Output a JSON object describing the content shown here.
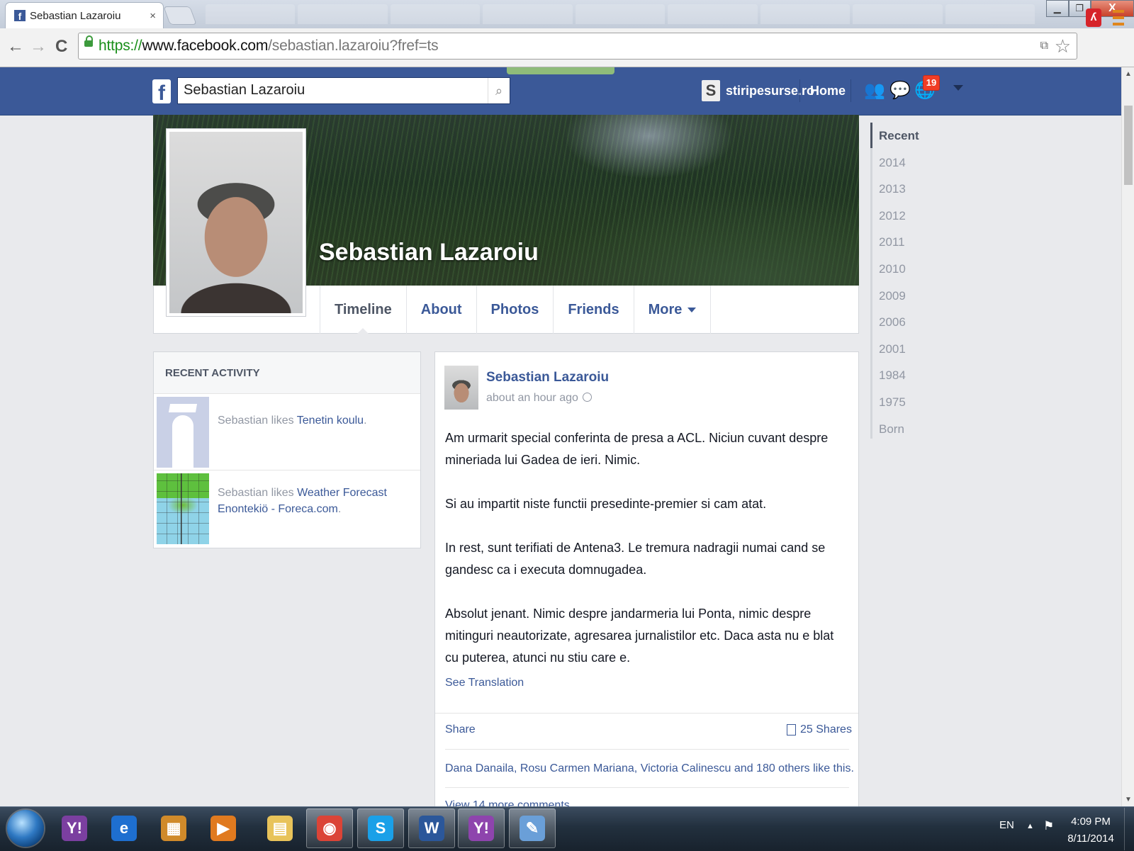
{
  "browser": {
    "tab_title": "Sebastian Lazaroiu",
    "tab_close": "×",
    "url_scheme": "https://",
    "url_host": "www.facebook.com",
    "url_path": "/sebastian.lazaroiu?fref=ts",
    "controls": {
      "minimize": "▁",
      "maximize": "❐",
      "close": "X"
    },
    "nav": {
      "back": "←",
      "forward": "→",
      "reload": "C"
    },
    "icons": [
      "lock-icon",
      "translate-icon",
      "star-icon",
      "extension-icon",
      "menu-icon"
    ]
  },
  "fb_nav": {
    "logo": "f",
    "search_value": "Sebastian Lazaroiu",
    "search_icon": "🔍",
    "page_link": "stiripesurse.ro",
    "page_icon": "S",
    "home": "Home",
    "notifications_count": "19",
    "jewels": [
      "friends-icon",
      "messages-icon",
      "notifications-icon"
    ]
  },
  "profile": {
    "name": "Sebastian Lazaroiu",
    "tabs": [
      "Timeline",
      "About",
      "Photos",
      "Friends",
      "More"
    ]
  },
  "recent_activity": {
    "title": "RECENT ACTIVITY",
    "items": [
      {
        "prefix": "Sebastian likes ",
        "object": "Tenetin koulu",
        "suffix": "."
      },
      {
        "prefix": "Sebastian likes ",
        "object": "Weather Forecast Enontekiö - Foreca.com",
        "suffix": "."
      }
    ]
  },
  "story": {
    "author": "Sebastian Lazaroiu",
    "time": "about an hour ago",
    "paragraphs": [
      "Am urmarit special conferinta de presa a ACL. Niciun cuvant despre mineriada lui Gadea de ieri. Nimic.",
      "Si au impartit niste functii presedinte-premier si cam atat.",
      "In rest, sunt terifiati de Antena3. Le tremura nadragii numai cand se gandesc ca i executa domnugadea.",
      "Absolut jenant. Nimic despre jandarmeria lui Ponta, nimic despre mitinguri neautorizate, agresarea jurnalistilor etc. Daca asta nu e blat cu puterea, atunci nu stiu care e."
    ],
    "see_translation": "See Translation",
    "share": "Share",
    "shares": "25 Shares",
    "likes": "Dana Danaila, Rosu Carmen Mariana, Victoria Calinescu and 180 others like this.",
    "more_comments": "View 14 more comments"
  },
  "timeline_years": [
    "Recent",
    "2014",
    "2013",
    "2012",
    "2011",
    "2010",
    "2009",
    "2006",
    "2001",
    "1984",
    "1975",
    "Born"
  ],
  "taskbar": {
    "apps": [
      {
        "name": "yahoo-messenger",
        "label": "Y!",
        "color": "#7b3fa0"
      },
      {
        "name": "internet-explorer",
        "label": "e",
        "color": "#1e6fd0"
      },
      {
        "name": "archive-app",
        "label": "▦",
        "color": "#d08a2a"
      },
      {
        "name": "media-player",
        "label": "▶",
        "color": "#e07a1f"
      },
      {
        "name": "file-explorer",
        "label": "▤",
        "color": "#e8c35a"
      },
      {
        "name": "chrome",
        "label": "◉",
        "color": "#db4437"
      },
      {
        "name": "skype",
        "label": "S",
        "color": "#1aa0e8"
      },
      {
        "name": "word",
        "label": "W",
        "color": "#2b579a"
      },
      {
        "name": "yahoo-messenger-2",
        "label": "Y!",
        "color": "#8e44ad"
      },
      {
        "name": "paint",
        "label": "✎",
        "color": "#6a9fd8"
      }
    ],
    "lang": "EN",
    "time": "4:09 PM",
    "date": "8/11/2014"
  }
}
